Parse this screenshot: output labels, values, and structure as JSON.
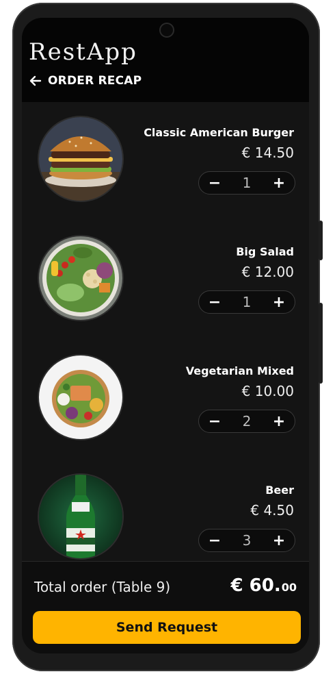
{
  "app": {
    "brand": "RestApp"
  },
  "header": {
    "title": "ORDER RECAP"
  },
  "items": [
    {
      "name": "Classic American Burger",
      "price": "€ 14.50",
      "qty": "1"
    },
    {
      "name": "Big Salad",
      "price": "€ 12.00",
      "qty": "1"
    },
    {
      "name": "Vegetarian Mixed",
      "price": "€ 10.00",
      "qty": "2"
    },
    {
      "name": "Beer",
      "price": "€ 4.50",
      "qty": "3"
    }
  ],
  "stepper": {
    "minus": "−",
    "plus": "+"
  },
  "footer": {
    "total_label": "Total order (Table 9)",
    "total_main": "€ 60.",
    "total_cents": "00",
    "send_label": "Send Request"
  },
  "colors": {
    "accent": "#ffb400",
    "background": "#141414",
    "header": "#050505"
  }
}
